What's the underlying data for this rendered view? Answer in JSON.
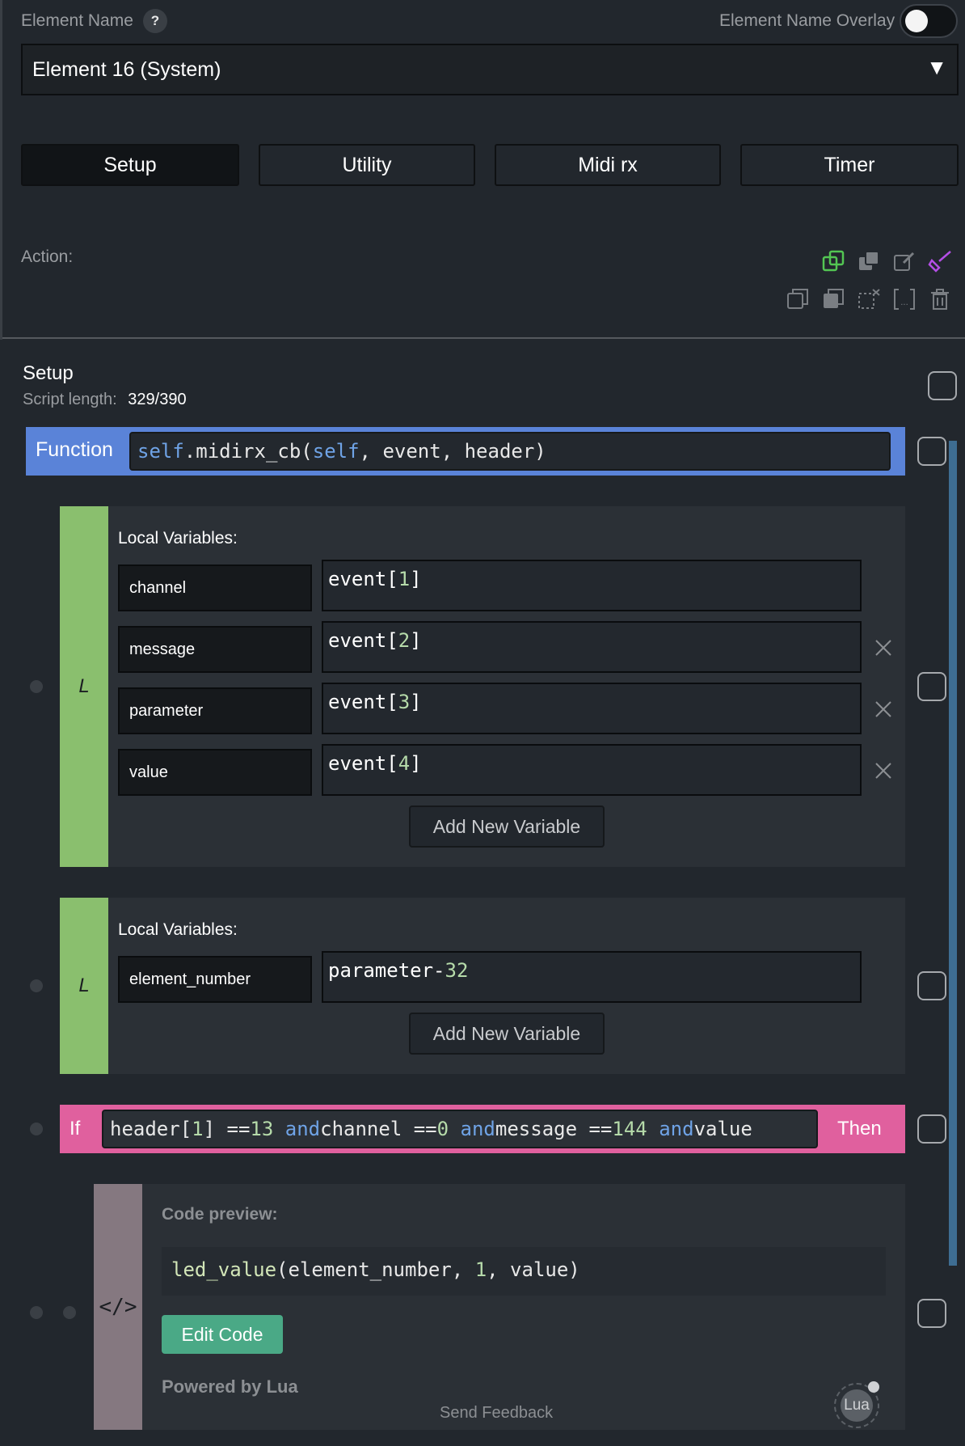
{
  "header": {
    "element_name_label": "Element Name",
    "help_label": "?",
    "overlay_label": "Element Name Overlay",
    "overlay_on": false,
    "selected_element": "Element 16 (System)",
    "dropdown_glyph": "▼"
  },
  "tabs": [
    {
      "label": "Setup",
      "active": true
    },
    {
      "label": "Utility",
      "active": false
    },
    {
      "label": "Midi rx",
      "active": false
    },
    {
      "label": "Timer",
      "active": false
    }
  ],
  "action": {
    "label": "Action:",
    "icons": [
      "copy-green-icon",
      "paste-icon",
      "edit-icon",
      "brush-icon",
      "duplicate-icon",
      "duplicate-filled-icon",
      "cut-icon",
      "bracket-icon",
      "delete-icon"
    ]
  },
  "setup": {
    "title": "Setup",
    "script_length_label": "Script length:",
    "script_length_value": "329/390"
  },
  "function_block": {
    "label": "Function",
    "self1": "self",
    "name": ".midirx_cb(",
    "self2": "self",
    "args": ", event, header)"
  },
  "locals_1": {
    "strip_letter": "L",
    "heading": "Local Variables:",
    "variables": [
      {
        "name": "channel",
        "value_base": "event[",
        "value_index": "1",
        "value_end": "]"
      },
      {
        "name": "message",
        "value_base": "event[",
        "value_index": "2",
        "value_end": "]"
      },
      {
        "name": "parameter",
        "value_base": "event[",
        "value_index": "3",
        "value_end": "]"
      },
      {
        "name": "value",
        "value_base": "event[",
        "value_index": "4",
        "value_end": "]"
      }
    ],
    "add_button": "Add New Variable"
  },
  "locals_2": {
    "strip_letter": "L",
    "heading": "Local Variables:",
    "variables": [
      {
        "name": "element_number",
        "value_base": "parameter-",
        "value_index": "32"
      }
    ],
    "add_button": "Add New Variable"
  },
  "if_block": {
    "if_label": "If",
    "then_label": "Then",
    "p1": "header[",
    "n1": "1",
    "p2": "] == ",
    "n2": "13",
    "and1": "and",
    "p3": " channel == ",
    "n3": "0",
    "and2": "and",
    "p4": " message == ",
    "n4": "144",
    "and3": "and",
    "p5": " value"
  },
  "code_block": {
    "strip_glyph": "</>",
    "preview_label": "Code preview:",
    "fn_name": "led_value",
    "code_rest_1": "(element_number, ",
    "code_num": "1",
    "code_rest_2": ", value)",
    "edit_button": "Edit Code",
    "powered_by": "Powered by Lua",
    "feedback": "Send Feedback",
    "lua_logo_text": "Lua"
  },
  "colors": {
    "function_bar": "#5a83d8",
    "local_strip": "#8abf6e",
    "if_bar": "#e0609e",
    "code_strip": "#857880",
    "edit_button": "#4aa986"
  }
}
